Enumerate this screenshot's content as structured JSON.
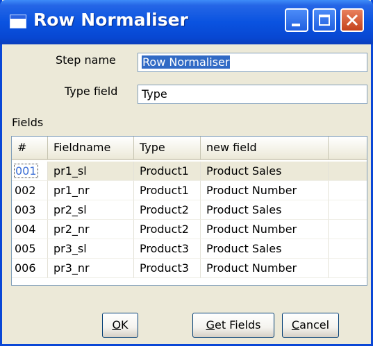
{
  "window": {
    "title": "Row Normaliser"
  },
  "form": {
    "step_name_label": "Step name",
    "step_name_value": "Row Normaliser",
    "type_field_label": "Type field",
    "type_field_value": "Type",
    "fields_label": "Fields"
  },
  "table": {
    "columns": [
      "#",
      "Fieldname",
      "Type",
      "new field",
      ""
    ],
    "rows": [
      {
        "num": "001",
        "fieldname": "pr1_sl",
        "type": "Product1",
        "new_field": "Product Sales"
      },
      {
        "num": "002",
        "fieldname": "pr1_nr",
        "type": "Product1",
        "new_field": "Product Number"
      },
      {
        "num": "003",
        "fieldname": "pr2_sl",
        "type": "Product2",
        "new_field": "Product Sales"
      },
      {
        "num": "004",
        "fieldname": "pr2_nr",
        "type": "Product2",
        "new_field": "Product Number"
      },
      {
        "num": "005",
        "fieldname": "pr3_sl",
        "type": "Product3",
        "new_field": "Product Sales"
      },
      {
        "num": "006",
        "fieldname": "pr3_nr",
        "type": "Product3",
        "new_field": "Product Number"
      }
    ],
    "selected_row": 0
  },
  "buttons": {
    "ok": {
      "mnemonic": "O",
      "rest": "K"
    },
    "get_fields": {
      "mnemonic": "G",
      "rest": "et Fields"
    },
    "cancel": {
      "mnemonic": "C",
      "rest": "ancel"
    }
  },
  "icons": {
    "title_icon": "window-app-icon",
    "minimize": "minimize-icon",
    "maximize": "maximize-icon",
    "close": "close-icon"
  },
  "colors": {
    "titlebar": "#0a53e0",
    "selection": "#316ac5",
    "close_button": "#c4421c"
  }
}
